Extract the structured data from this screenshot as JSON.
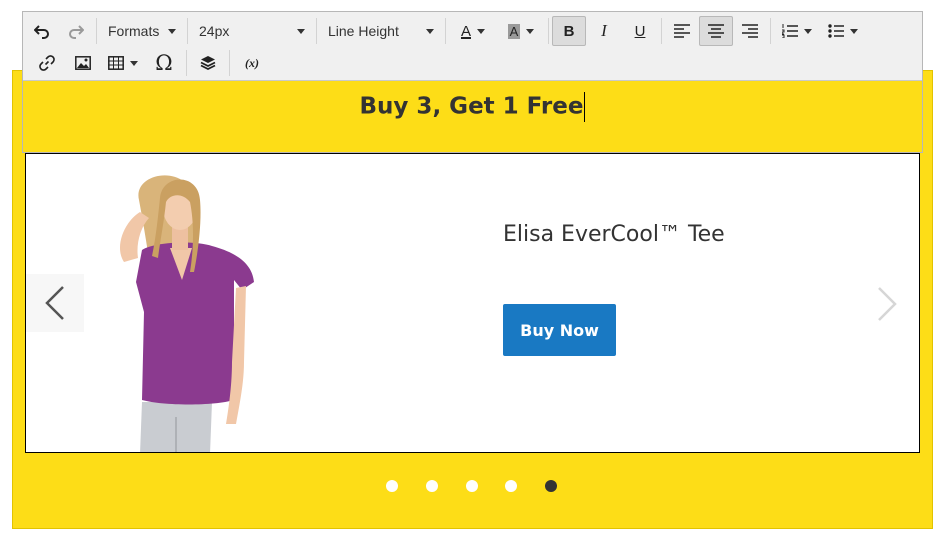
{
  "toolbar": {
    "formats_label": "Formats",
    "font_size_value": "24px",
    "line_height_label": "Line Height",
    "special_char_glyph": "Ω",
    "variable_glyph": "(x)",
    "bold_glyph": "B",
    "italic_glyph": "I",
    "underline_glyph": "U",
    "text_color_glyph": "A",
    "bg_color_glyph": "A",
    "active_buttons": [
      "bold",
      "align-center"
    ]
  },
  "editor": {
    "headline": "Buy 3, Get 1 Free"
  },
  "slide": {
    "product_name": "Elisa EverCool™ Tee",
    "button_label": "Buy Now"
  },
  "dots": {
    "count": 5,
    "active_index": 4
  },
  "colors": {
    "banner_yellow": "#fddd17",
    "button_blue": "#1979c3",
    "headline_text": "#333333",
    "toolbar_bg": "#f0f0f0",
    "shirt_purple": "#8b3a8f"
  }
}
